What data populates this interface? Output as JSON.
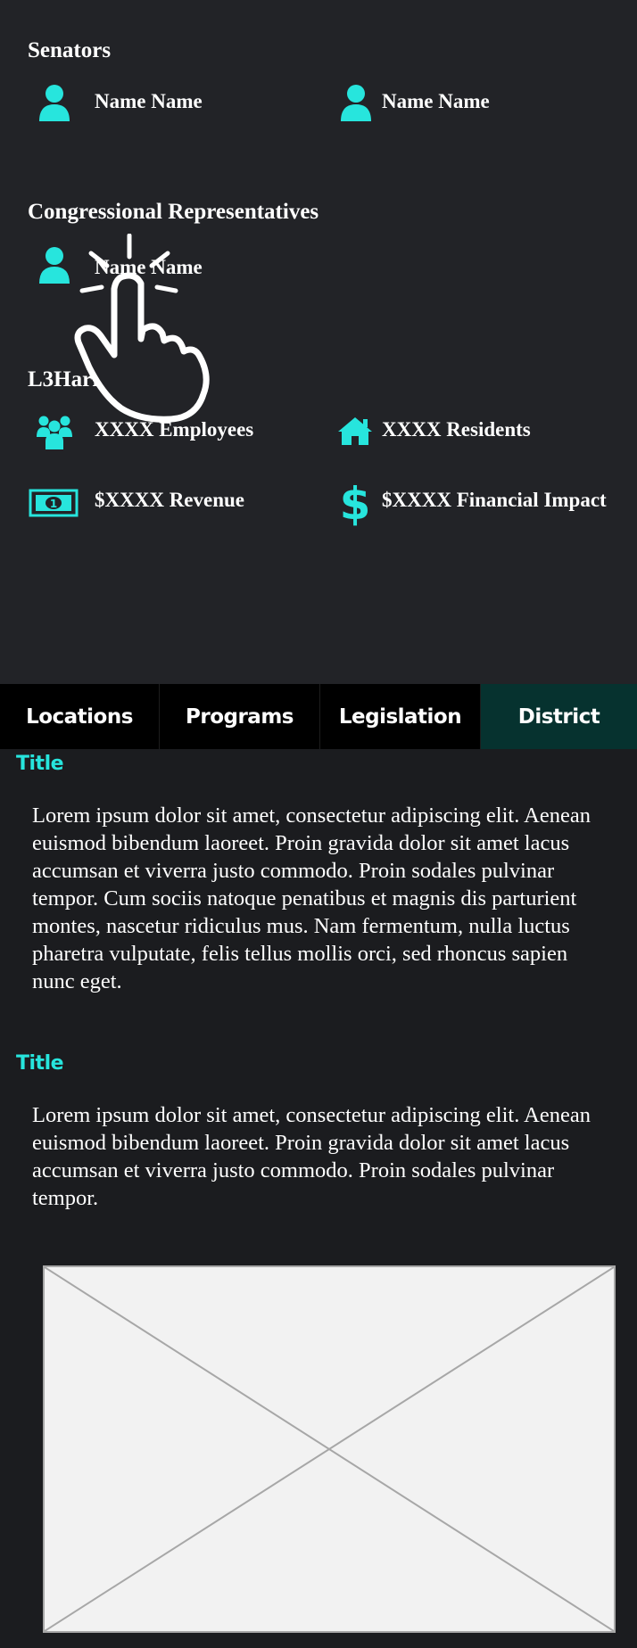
{
  "senators": {
    "heading": "Senators",
    "names": [
      "Name Name",
      "Name Name"
    ]
  },
  "representatives": {
    "heading": "Congressional Representatives",
    "names": [
      "Name Name"
    ]
  },
  "district": {
    "heading": "L3Harris In Dist. 8",
    "stats": {
      "employees": "XXXX Employees",
      "residents": "XXXX Residents",
      "revenue": "$XXXX Revenue",
      "impact": "$XXXX Financial Impact"
    }
  },
  "tabs": [
    "Locations",
    "Programs",
    "Legislation",
    "District"
  ],
  "active_tab": "District",
  "sections": [
    {
      "title": "Title",
      "body": "Lorem ipsum dolor sit amet, consectetur adipiscing elit. Aenean euismod bibendum laoreet. Proin gravida dolor sit amet lacus accumsan et viverra justo commodo. Proin sodales pulvinar tempor. Cum sociis natoque penatibus et magnis dis parturient montes, nascetur ridiculus mus. Nam fermentum, nulla luctus pharetra vulputate, felis tellus mollis orci, sed rhoncus sapien nunc eget."
    },
    {
      "title": "Title",
      "body": "Lorem ipsum dolor sit amet, consectetur adipiscing elit. Aenean euismod bibendum laoreet. Proin gravida dolor sit amet lacus accumsan et viverra justo commodo. Proin sodales pulvinar tempor."
    }
  ],
  "colors": {
    "accent": "#27e5dd",
    "active_tab_bg": "#06322f",
    "top_bg": "#222327",
    "content_bg": "#1b1c1f"
  },
  "icons": [
    "person-icon",
    "people-group-icon",
    "house-icon",
    "money-bill-icon",
    "dollar-sign-icon",
    "image-placeholder-icon",
    "tap-cursor-icon"
  ]
}
